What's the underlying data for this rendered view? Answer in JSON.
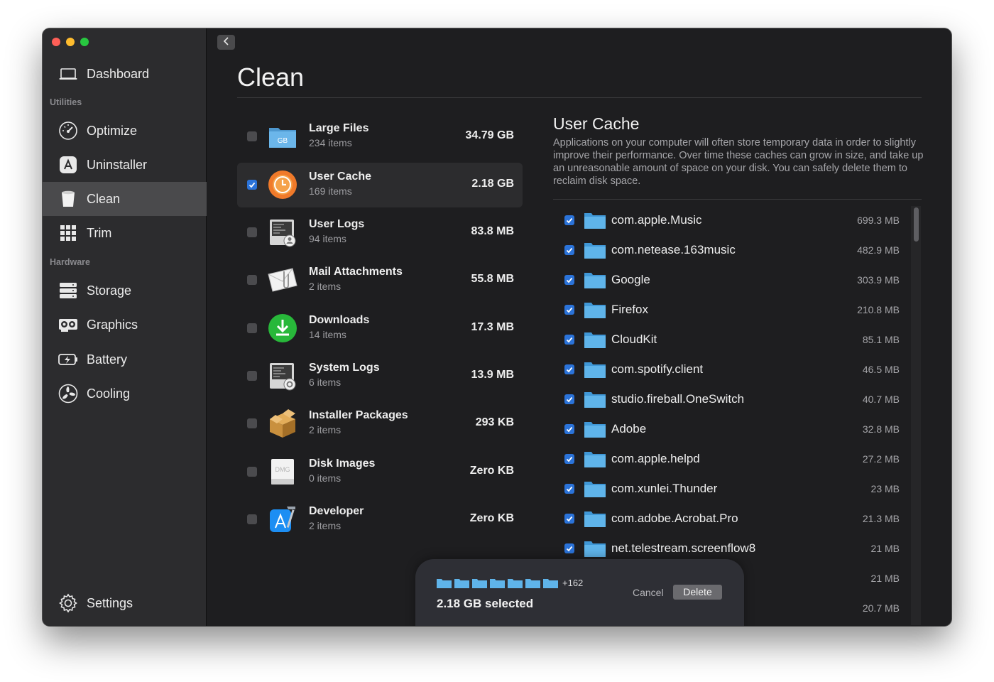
{
  "sidebar": {
    "dashboard": "Dashboard",
    "section_utilities": "Utilities",
    "optimize": "Optimize",
    "uninstaller": "Uninstaller",
    "clean": "Clean",
    "trim": "Trim",
    "section_hardware": "Hardware",
    "storage": "Storage",
    "graphics": "Graphics",
    "battery": "Battery",
    "cooling": "Cooling",
    "settings": "Settings"
  },
  "main": {
    "title": "Clean",
    "categories": [
      {
        "name": "Large Files",
        "count": "234 items",
        "size": "34.79 GB",
        "checked": false,
        "icon": "gb-folder-icon"
      },
      {
        "name": "User Cache",
        "count": "169 items",
        "size": "2.18 GB",
        "checked": true,
        "icon": "clock-icon"
      },
      {
        "name": "User Logs",
        "count": "94 items",
        "size": "83.8 MB",
        "checked": false,
        "icon": "user-log-icon"
      },
      {
        "name": "Mail Attachments",
        "count": "2 items",
        "size": "55.8 MB",
        "checked": false,
        "icon": "mail-attachment-icon"
      },
      {
        "name": "Downloads",
        "count": "14 items",
        "size": "17.3 MB",
        "checked": false,
        "icon": "download-icon"
      },
      {
        "name": "System Logs",
        "count": "6 items",
        "size": "13.9 MB",
        "checked": false,
        "icon": "system-log-icon"
      },
      {
        "name": "Installer Packages",
        "count": "2 items",
        "size": "293 KB",
        "checked": false,
        "icon": "package-icon"
      },
      {
        "name": "Disk Images",
        "count": "0 items",
        "size": "Zero KB",
        "checked": false,
        "icon": "dmg-icon"
      },
      {
        "name": "Developer",
        "count": "2 items",
        "size": "Zero KB",
        "checked": false,
        "icon": "xcode-icon"
      }
    ],
    "detail": {
      "title": "User Cache",
      "description": "Applications on your computer will often store temporary data in order to slightly improve their performance. Over time these caches can grow in size, and take up an unreasonable amount of space on your disk. You can safely delete them to reclaim disk space.",
      "files": [
        {
          "name": "com.apple.Music",
          "size": "699.3 MB"
        },
        {
          "name": "com.netease.163music",
          "size": "482.9 MB"
        },
        {
          "name": "Google",
          "size": "303.9 MB"
        },
        {
          "name": "Firefox",
          "size": "210.8 MB"
        },
        {
          "name": "CloudKit",
          "size": "85.1 MB"
        },
        {
          "name": "com.spotify.client",
          "size": "46.5 MB"
        },
        {
          "name": "studio.fireball.OneSwitch",
          "size": "40.7 MB"
        },
        {
          "name": "Adobe",
          "size": "32.8 MB"
        },
        {
          "name": "com.apple.helpd",
          "size": "27.2 MB"
        },
        {
          "name": "com.xunlei.Thunder",
          "size": "23 MB"
        },
        {
          "name": "com.adobe.Acrobat.Pro",
          "size": "21.3 MB"
        },
        {
          "name": "net.telestream.screenflow8",
          "size": "21 MB"
        },
        {
          "name": "",
          "size": "21 MB"
        },
        {
          "name": "",
          "size": "20.7 MB"
        }
      ]
    }
  },
  "bottom": {
    "more_count": "+162",
    "selected_text": "2.18 GB selected",
    "cancel": "Cancel",
    "delete": "Delete"
  },
  "colors": {
    "accent": "#2b73d9",
    "folder": "#5fb4ea",
    "sidebar_bg": "#2c2c2e",
    "window_bg": "#1e1e20"
  }
}
